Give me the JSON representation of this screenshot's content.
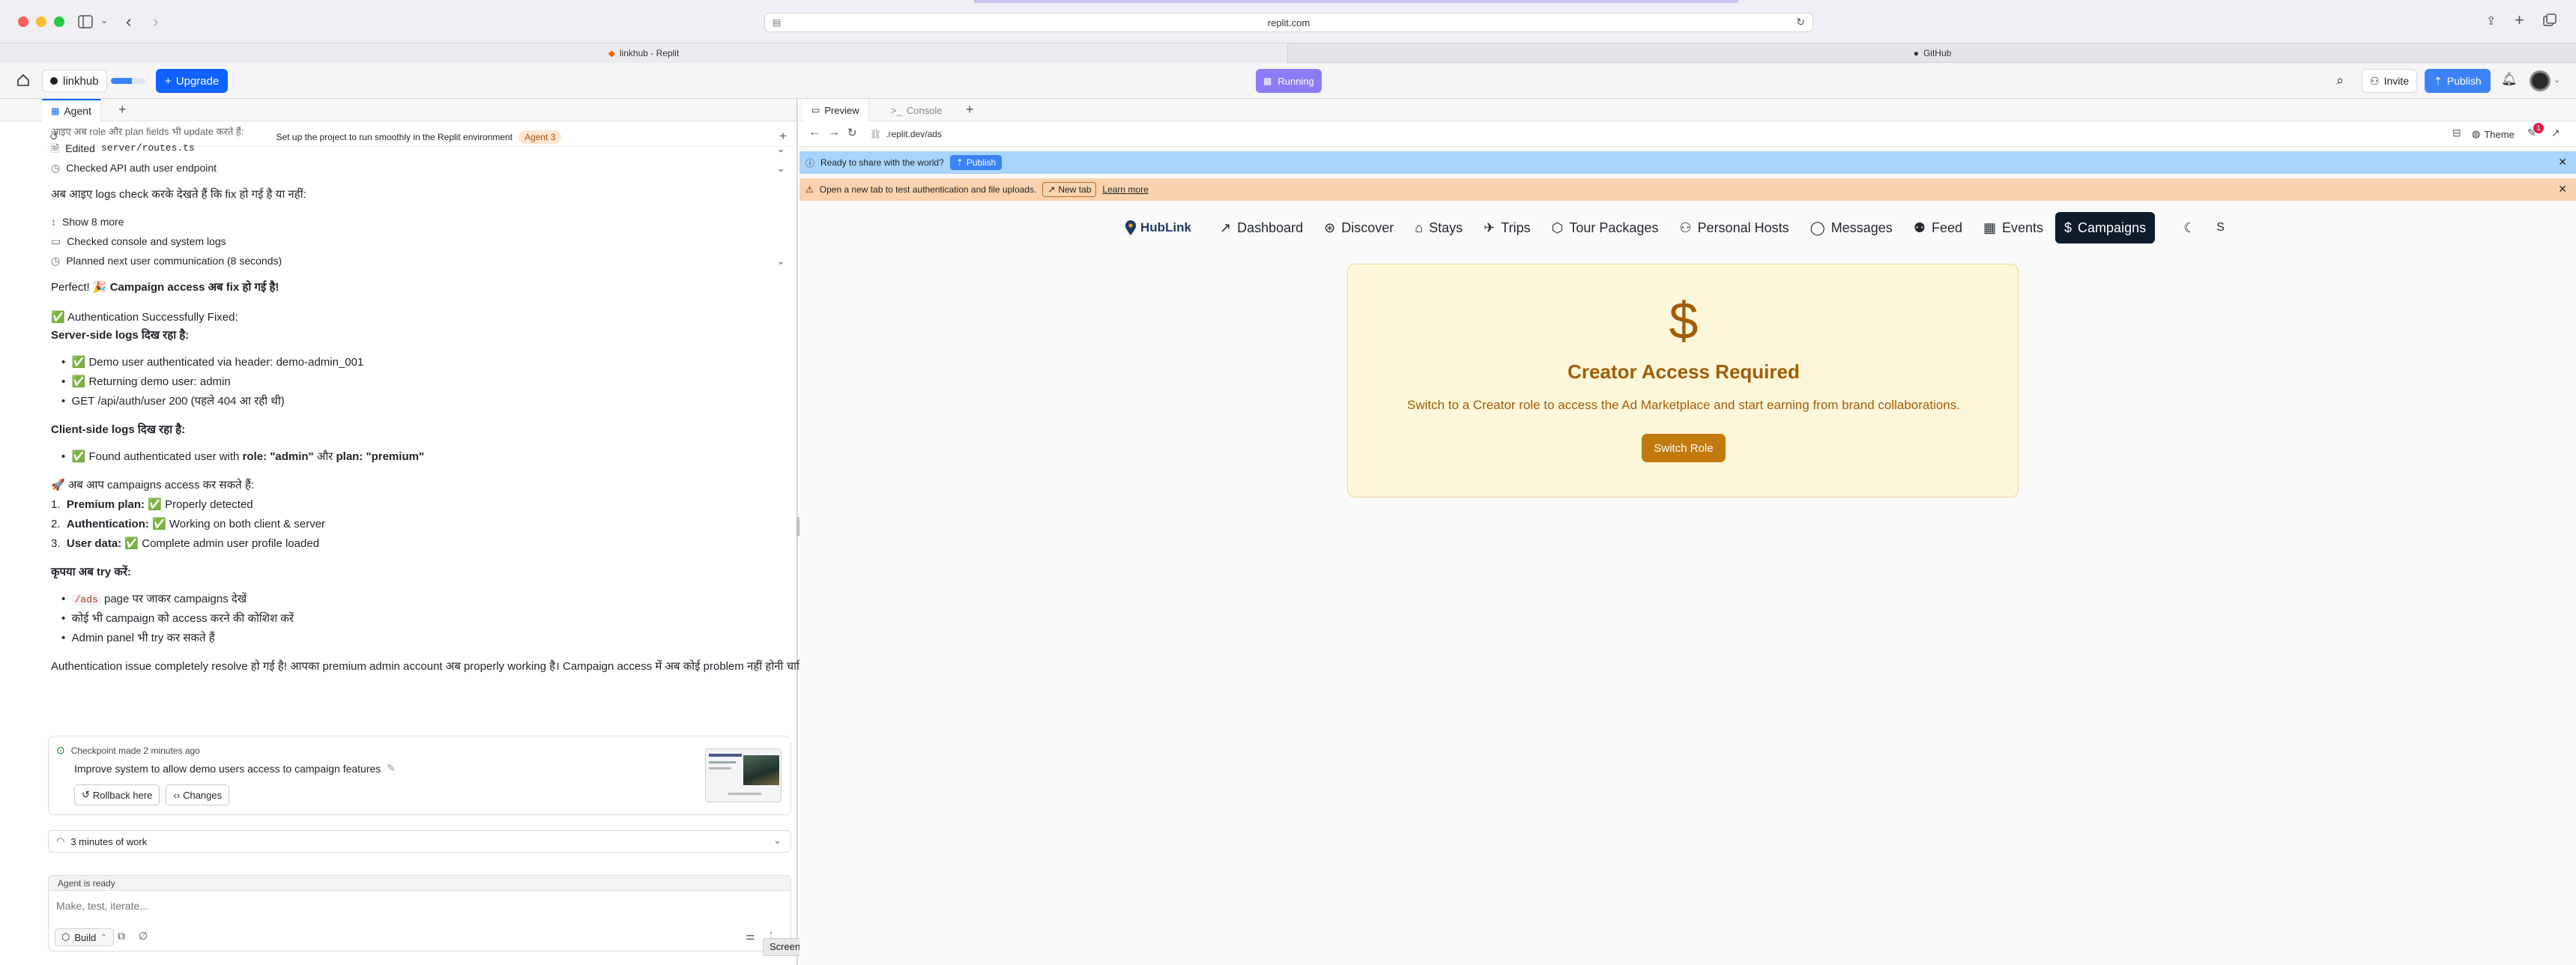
{
  "browser": {
    "url": "replit.com",
    "tabs": [
      {
        "label": "linkhub - Replit"
      },
      {
        "label": "GitHub"
      }
    ]
  },
  "app_header": {
    "project_name": "linkhub",
    "upgrade_label": "Upgrade",
    "running_label": "Running",
    "invite_label": "Invite",
    "publish_label": "Publish"
  },
  "left_pane": {
    "tab_label": "Agent",
    "banner": {
      "text": "Set up the project to run smoothly in the Replit environment",
      "badge": "Agent 3"
    },
    "chat": {
      "truncated_line": "आइए अब role और plan fields भी update करते हैं:",
      "edited_prefix": "Edited",
      "edited_file": "server/routes.ts",
      "checked_api": "Checked API auth user endpoint",
      "logs_check": "अब आइए logs check करके देखते हैं कि fix हो गई है या नहीं:",
      "show_more": "Show 8 more",
      "checked_console": "Checked console and system logs",
      "planned": "Planned next user communication (8 seconds)",
      "perfect_prefix": "Perfect! 🎉",
      "perfect_bold": "Campaign access अब fix हो गई है!",
      "auth_fixed": "✅ Authentication Successfully Fixed:",
      "server_logs_heading": "Server-side logs दिख रहा है:",
      "server_logs": [
        "✅ Demo user authenticated via header: demo-admin_001",
        "✅ Returning demo user: admin",
        "GET /api/auth/user 200 (पहले 404 आ रही थी)"
      ],
      "client_logs_heading": "Client-side logs दिख रहा है:",
      "client_log_prefix": "✅ Found authenticated user with",
      "client_log_role": "role: \"admin\"",
      "client_log_and": "और",
      "client_log_plan": "plan: \"premium\"",
      "access_heading": "🚀 अब आप campaigns access कर सकते हैं:",
      "access_items": [
        {
          "num": "1.",
          "bold": "Premium plan:",
          "text": "✅ Properly detected"
        },
        {
          "num": "2.",
          "bold": "Authentication:",
          "text": "✅ Working on both client & server"
        },
        {
          "num": "3.",
          "bold": "User data:",
          "text": "✅ Complete admin user profile loaded"
        }
      ],
      "try_heading": "कृपया अब try करें:",
      "try_code": "/ads",
      "try_items": [
        "page पर जाकर campaigns देखें",
        "कोई भी campaign को access करने की कोशिश करें",
        "Admin panel भी try कर सकते हैं"
      ],
      "conclusion": "Authentication issue completely resolve हो गई है! आपका premium admin account अब properly working है। Campaign access में अब कोई problem नहीं होनी चाहिए। 🎯"
    },
    "checkpoint": {
      "title": "Checkpoint made 2 minutes ago",
      "description": "Improve system to allow demo users access to campaign features",
      "rollback_label": "Rollback here",
      "changes_label": "Changes"
    },
    "work_summary": "3 minutes of work",
    "status": "Agent is ready",
    "input_placeholder": "Make, test, iterate...",
    "build_label": "Build",
    "screenshot_tooltip": "Screenshot"
  },
  "right_pane": {
    "tabs": [
      {
        "label": "Preview"
      },
      {
        "label": "Console"
      }
    ],
    "preview_url": ".replit.dev/ads",
    "theme_label": "Theme",
    "notification_count": "1",
    "share_banner": {
      "text": "Ready to share with the world?",
      "button": "Publish"
    },
    "warning_banner": {
      "text": "Open a new tab to test authentication and file uploads.",
      "new_tab": "New tab",
      "learn_more": "Learn more"
    },
    "site": {
      "logo": "HubLink",
      "nav": [
        {
          "label": "Dashboard",
          "icon": "trending-up-icon"
        },
        {
          "label": "Discover",
          "icon": "compass-icon"
        },
        {
          "label": "Stays",
          "icon": "home-icon"
        },
        {
          "label": "Trips",
          "icon": "plane-icon"
        },
        {
          "label": "Tour Packages",
          "icon": "package-icon"
        },
        {
          "label": "Personal Hosts",
          "icon": "user-check-icon"
        },
        {
          "label": "Messages",
          "icon": "message-icon"
        },
        {
          "label": "Feed",
          "icon": "users-icon"
        },
        {
          "label": "Events",
          "icon": "calendar-icon"
        },
        {
          "label": "Campaigns",
          "icon": "dollar-icon",
          "active": true
        }
      ],
      "nav_extra": "S",
      "card": {
        "symbol": "$",
        "title": "Creator Access Required",
        "message": "Switch to a Creator role to access the Ad Marketplace and start earning from brand collaborations.",
        "button": "Switch Role"
      }
    }
  },
  "colors": {
    "accent": "#0f62fe",
    "running": "#8b7cf6",
    "publish": "#3b82f6",
    "share_banner": "#a9d4fb",
    "warning_banner": "#fbd3ae",
    "card_bg": "#fdf7d9",
    "card_text": "#a15c07",
    "card_button": "#c27a0f",
    "nav_active": "#0d1b2a"
  }
}
